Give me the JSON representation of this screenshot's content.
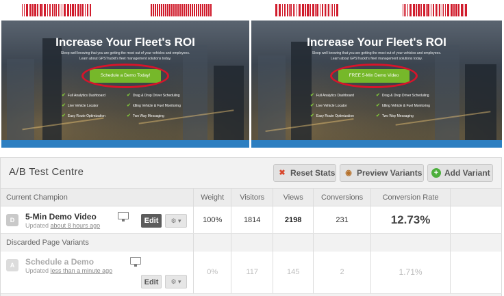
{
  "previews": [
    {
      "title": "Increase Your Fleet's ROI",
      "subtitle_lines": [
        "Sleep well knowing that you are getting the most out of your vehicles and employees.",
        "Learn about GPSTrackit's fleet management solutions today."
      ],
      "cta_label": "Schedule a Demo Today!",
      "features": [
        "Full Analytics Dashboard",
        "Drag & Drop Driver Scheduling",
        "Live Vehicle Locator",
        "Idling Vehicle & Fuel Monitoring",
        "Easy Route Optimization",
        "Two Way Messaging"
      ]
    },
    {
      "title": "Increase Your Fleet's ROI",
      "subtitle_lines": [
        "Sleep well knowing that you are getting the most out of your vehicles and employees.",
        "Learn about GPSTrackit's fleet management solutions today."
      ],
      "cta_label": "FREE 5-Min Demo Video",
      "features": [
        "Full Analytics Dashboard",
        "Drag & Drop Driver Scheduling",
        "Live Vehicle Locator",
        "Idling Vehicle & Fuel Monitoring",
        "Easy Route Optimization",
        "Two Way Messaging"
      ]
    }
  ],
  "colors": {
    "highlight_ring": "#d8142a",
    "cta_green": "#76b82a",
    "footer_blue": "#2d7fc1",
    "redaction": "#d01c2c"
  },
  "panel": {
    "title": "A/B Test Centre",
    "buttons": {
      "reset": "Reset Stats",
      "preview": "Preview Variants",
      "add": "Add Variant"
    },
    "icons": {
      "reset": "reset-stats-icon",
      "preview": "eye-icon",
      "add": "plus-circle-icon"
    },
    "columns": {
      "variant": "Current Champion",
      "weight": "Weight",
      "visitors": "Visitors",
      "views": "Views",
      "conversions": "Conversions",
      "rate": "Conversion Rate"
    },
    "champion": {
      "letter": "D",
      "name": "5-Min Demo Video",
      "updated_prefix": "Updated",
      "updated_link": "about 8 hours ago",
      "edit": "Edit",
      "gear": "⚙ ▾",
      "weight": "100%",
      "visitors": "1814",
      "views": "2198",
      "conversions": "231",
      "rate": "12.73%"
    },
    "discarded_heading": "Discarded Page Variants",
    "discarded": {
      "letter": "A",
      "name": "Schedule a Demo",
      "updated_prefix": "Updated",
      "updated_link": "less than a minute ago",
      "edit": "Edit",
      "gear": "⚙ ▾",
      "weight": "0%",
      "visitors": "117",
      "views": "145",
      "conversions": "2",
      "rate": "1.71%"
    }
  }
}
